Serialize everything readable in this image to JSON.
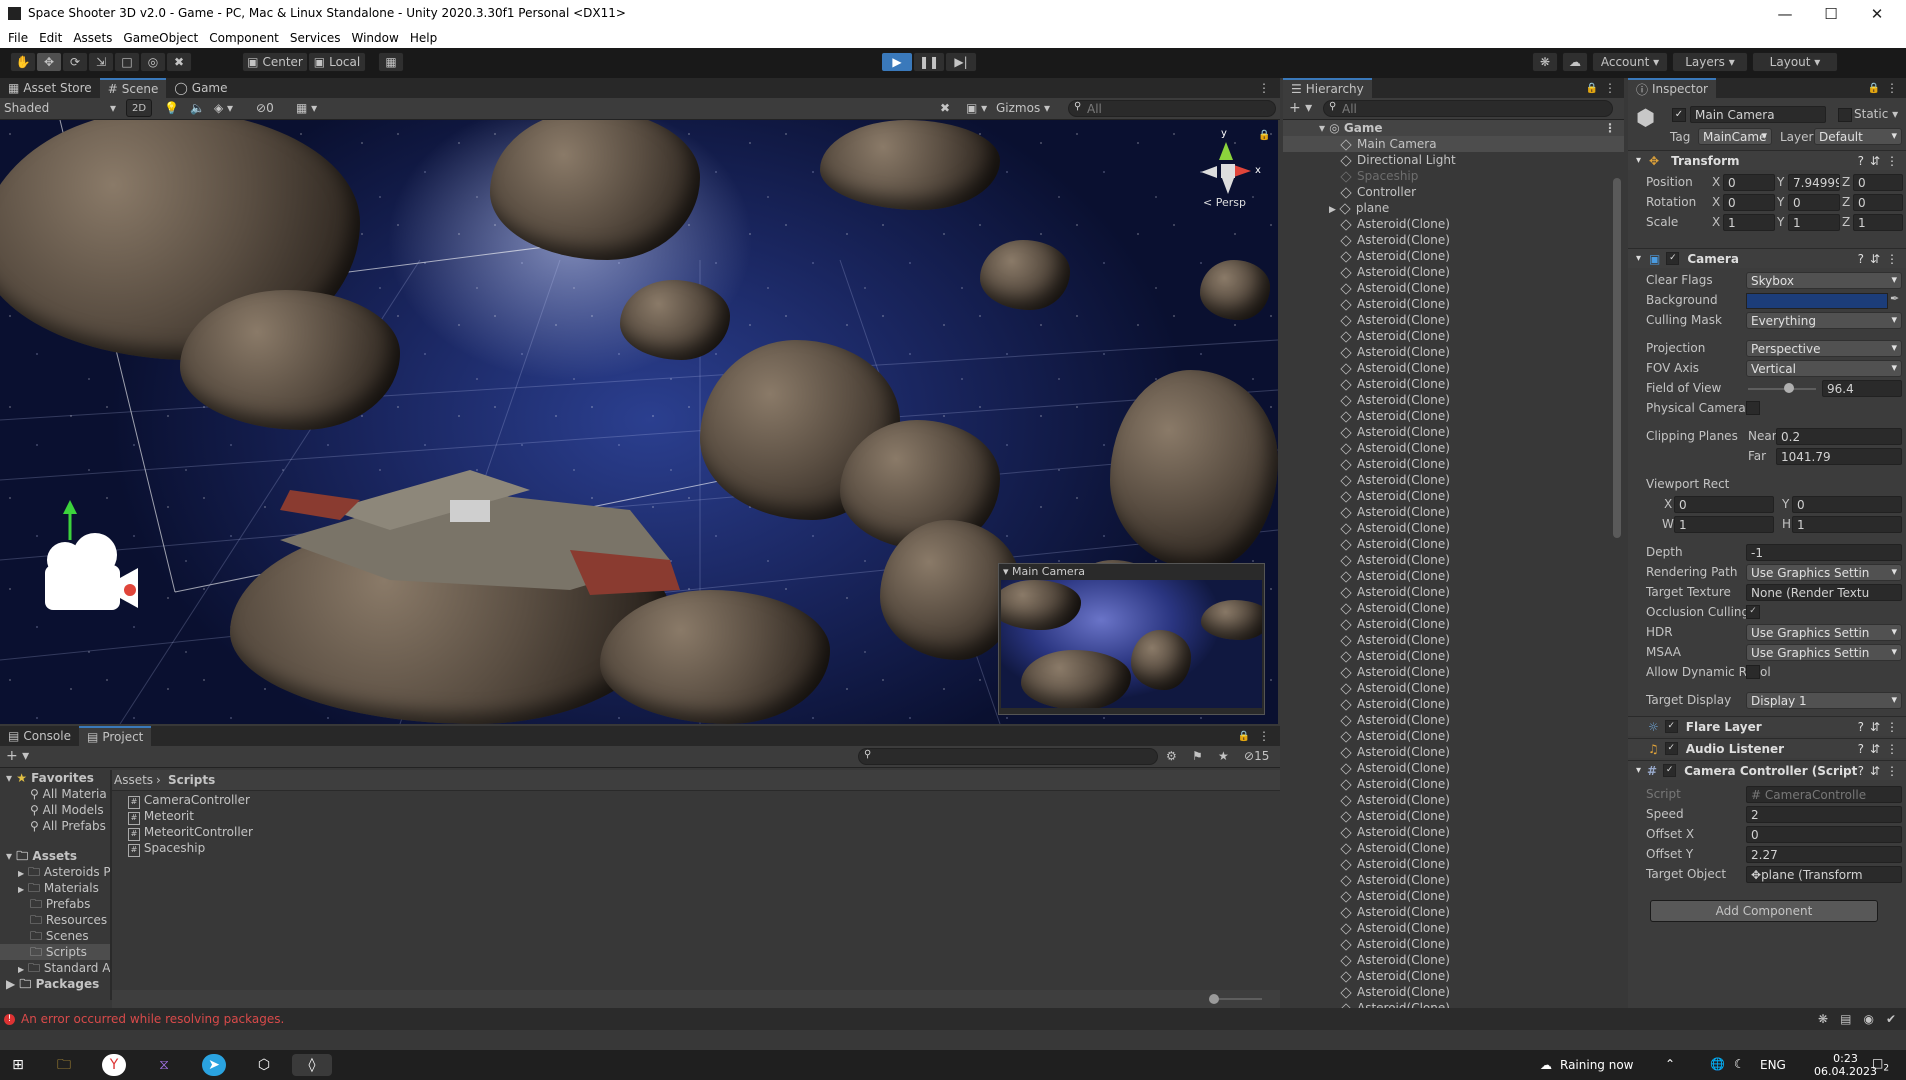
{
  "window": {
    "title": "Space Shooter 3D v2.0 - Game - PC, Mac & Linux Standalone - Unity 2020.3.30f1 Personal <DX11>"
  },
  "menu": [
    "File",
    "Edit",
    "Assets",
    "GameObject",
    "Component",
    "Services",
    "Window",
    "Help"
  ],
  "toolbar": {
    "pivot": "Center",
    "space": "Local",
    "account": "Account",
    "layers": "Layers",
    "layout": "Layout"
  },
  "scene_panel": {
    "tabs": [
      "Asset Store",
      "Scene",
      "Game"
    ],
    "shading": "Shaded",
    "mode_2d": "2D",
    "hidden_count": "0",
    "gizmos": "Gizmos",
    "search_placeholder": "All",
    "persp_label": "< Persp",
    "axis_y": "y",
    "axis_x": "x",
    "camera_preview_title": "Main Camera"
  },
  "hierarchy": {
    "title": "Hierarchy",
    "search_placeholder": "All",
    "scene_name": "Game",
    "items": [
      "Main Camera",
      "Directional Light",
      "Spaceship",
      "Controller",
      "plane"
    ],
    "clone_label": "Asteroid(Clone)",
    "clone_rows": 50
  },
  "inspector": {
    "title": "Inspector",
    "object_name": "Main Camera",
    "static_label": "Static",
    "tag_label": "Tag",
    "tag_value": "MainCame",
    "layer_label": "Layer",
    "layer_value": "Default",
    "transform": {
      "title": "Transform",
      "position_label": "Position",
      "rotation_label": "Rotation",
      "scale_label": "Scale",
      "position": {
        "x": "0",
        "y": "7.94999",
        "z": "0"
      },
      "rotation": {
        "x": "0",
        "y": "0",
        "z": "0"
      },
      "scale": {
        "x": "1",
        "y": "1",
        "z": "1"
      }
    },
    "camera": {
      "title": "Camera",
      "clear_flags_label": "Clear Flags",
      "clear_flags": "Skybox",
      "background_label": "Background",
      "background_color": "#1c3d7a",
      "culling_mask_label": "Culling Mask",
      "culling_mask": "Everything",
      "projection_label": "Projection",
      "projection": "Perspective",
      "fov_axis_label": "FOV Axis",
      "fov_axis": "Vertical",
      "fov_label": "Field of View",
      "fov": "96.4",
      "physical_label": "Physical Camera",
      "clipping_label": "Clipping Planes",
      "near_label": "Near",
      "near": "0.2",
      "far_label": "Far",
      "far": "1041.79",
      "viewport_label": "Viewport Rect",
      "vx": "0",
      "vy": "0",
      "vw": "1",
      "vh": "1",
      "depth_label": "Depth",
      "depth": "-1",
      "rendering_path_label": "Rendering Path",
      "rendering_path": "Use Graphics Settin",
      "target_texture_label": "Target Texture",
      "target_texture": "None (Render Textu",
      "occlusion_label": "Occlusion Culling",
      "hdr_label": "HDR",
      "hdr": "Use Graphics Settin",
      "msaa_label": "MSAA",
      "msaa": "Use Graphics Settin",
      "dynres_label": "Allow Dynamic Resol",
      "target_display_label": "Target Display",
      "target_display": "Display 1"
    },
    "flare_layer": "Flare Layer",
    "audio_listener": "Audio Listener",
    "camera_controller": {
      "title": "Camera Controller (Script",
      "script_label": "Script",
      "script": "CameraControlle",
      "speed_label": "Speed",
      "speed": "2",
      "offset_x_label": "Offset X",
      "offset_x": "0",
      "offset_y_label": "Offset Y",
      "offset_y": "2.27",
      "target_label": "Target Object",
      "target": "plane (Transform"
    },
    "add_component": "Add Component"
  },
  "project_panel": {
    "tabs": [
      "Console",
      "Project"
    ],
    "favorites_label": "Favorites",
    "favorites": [
      "All Materia",
      "All Models",
      "All Prefabs"
    ],
    "assets_label": "Assets",
    "asset_folders": [
      "Asteroids P",
      "Materials",
      "Prefabs",
      "Resources",
      "Scenes",
      "Scripts",
      "Standard A"
    ],
    "packages_label": "Packages",
    "breadcrumb": [
      "Assets",
      "Scripts"
    ],
    "files": [
      "CameraController",
      "Meteorit",
      "MeteoritController",
      "Spaceship"
    ],
    "hidden_count": "15"
  },
  "status": {
    "error": "An error occurred while resolving packages."
  },
  "taskbar": {
    "weather": "Raining now",
    "lang": "ENG",
    "time": "0:23",
    "date": "06.04.2023",
    "notifications": "2"
  }
}
